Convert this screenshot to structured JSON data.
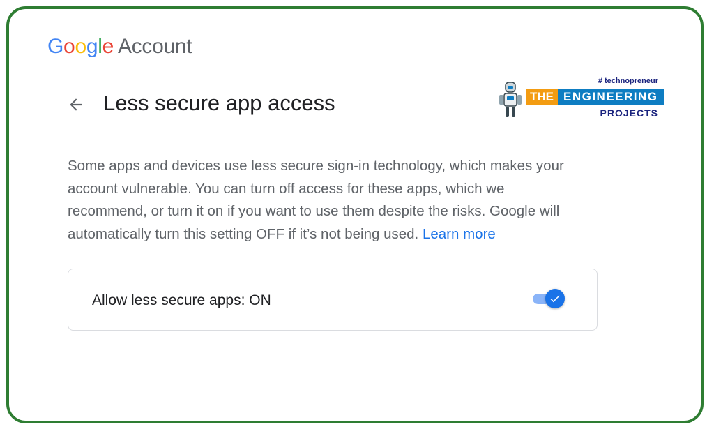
{
  "header": {
    "google_letters": [
      "G",
      "o",
      "o",
      "g",
      "l",
      "e"
    ],
    "google_colors": [
      "#4285F4",
      "#EA4335",
      "#FBBC05",
      "#4285F4",
      "#34A853",
      "#EA4335"
    ],
    "account_label": "Account"
  },
  "page": {
    "back_icon": "arrow-left-icon",
    "title": "Less secure app access"
  },
  "watermark": {
    "tag": "# technopreneur",
    "the": "THE",
    "engineering": "ENGINEERING",
    "projects": "PROJECTS"
  },
  "description": {
    "text": "Some apps and devices use less secure sign-in technology, which makes your account vulnerable. You can turn off access for these apps, which we recommend, or turn it on if you want to use them despite the risks. Google will automatically turn this setting OFF if it’s not being used.",
    "link_label": "Learn more"
  },
  "setting": {
    "label": "Allow less secure apps: ON",
    "toggle_state": "on",
    "toggle_icon": "checkmark-icon"
  },
  "colors": {
    "frame": "#2e7d32",
    "accent": "#1a73e8",
    "toggle_track": "#8ab4f8"
  }
}
